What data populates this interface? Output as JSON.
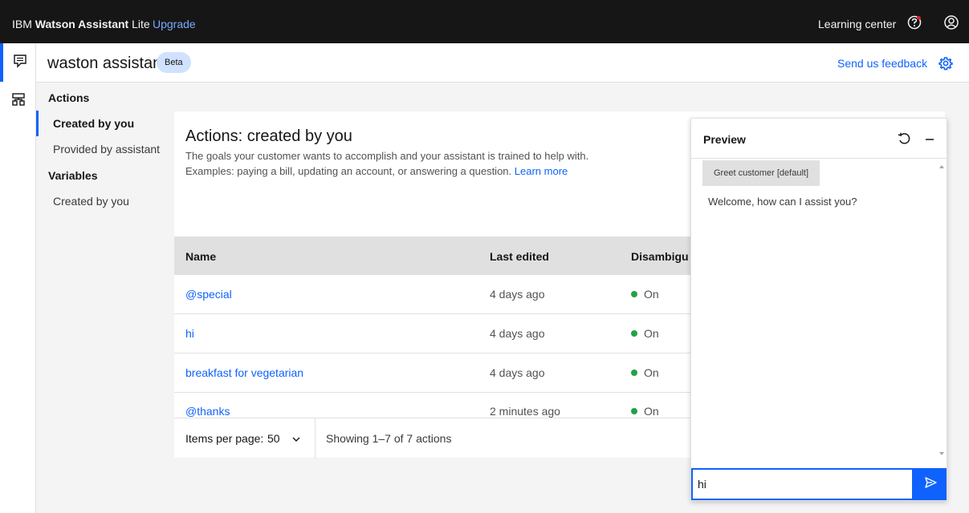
{
  "topbar": {
    "brand_prefix": "IBM",
    "brand_bold": "Watson Assistant",
    "brand_suffix": "Lite",
    "upgrade_label": "Upgrade",
    "learning_center_label": "Learning center",
    "help_icon": "help-icon",
    "user_icon": "user-avatar-icon"
  },
  "rail": {
    "items": [
      {
        "icon": "chat-icon",
        "active": true
      },
      {
        "icon": "integrations-icon",
        "active": false
      }
    ]
  },
  "header": {
    "assistant_name": "waston assistant",
    "badge": "Beta",
    "feedback_label": "Send us feedback",
    "settings_icon": "gear-icon"
  },
  "sidenav": {
    "actions_heading": "Actions",
    "actions_items": [
      {
        "label": "Created by you",
        "active": true
      },
      {
        "label": "Provided by assistant",
        "active": false
      }
    ],
    "variables_heading": "Variables",
    "variables_items": [
      {
        "label": "Created by you",
        "active": false
      }
    ]
  },
  "main": {
    "title": "Actions: created by you",
    "description_line1": "The goals your customer wants to accomplish and your assistant is trained to help with.",
    "description_line2": "Examples: paying a bill, updating an account, or answering a question.",
    "learn_more": "Learn more",
    "table": {
      "columns": [
        "Name",
        "Last edited",
        "Disambigu"
      ],
      "rows": [
        {
          "name": "@special",
          "last_edited": "4 days ago",
          "disambiguation": "On"
        },
        {
          "name": "hi",
          "last_edited": "4 days ago",
          "disambiguation": "On"
        },
        {
          "name": "breakfast for vegetarian",
          "last_edited": "4 days ago",
          "disambiguation": "On"
        },
        {
          "name": "@thanks",
          "last_edited": "2 minutes ago",
          "disambiguation": "On"
        }
      ]
    },
    "pagination": {
      "items_per_page_label": "Items per page:",
      "items_per_page_value": "50",
      "showing": "Showing 1–7 of 7 actions"
    }
  },
  "preview": {
    "title": "Preview",
    "restart_icon": "restart-icon",
    "minimize_icon": "minimize-icon",
    "greet_chip": "Greet customer [default]",
    "welcome_message": "Welcome, how can I assist you?",
    "input_value": "hi",
    "send_icon": "send-icon"
  },
  "colors": {
    "topbar_bg": "#161616",
    "accent": "#0f62fe",
    "status_on": "#24a148",
    "beta_bg": "#d0e2ff"
  }
}
